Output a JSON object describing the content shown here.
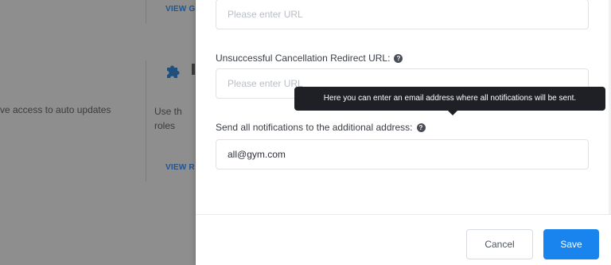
{
  "background": {
    "link_top": "VIEW G",
    "text_left": "ve access to auto updates",
    "desc": "Use th\nroles",
    "link_mid": "VIEW R"
  },
  "form": {
    "url_field": {
      "placeholder": "Please enter URL",
      "value": ""
    },
    "unsuccessful_label": "Unsuccessful Cancellation Redirect URL:",
    "unsuccessful_field": {
      "placeholder": "Please enter URL",
      "value": ""
    },
    "notify_label": "Send all notifications to the additional address:",
    "notify_field": {
      "placeholder": "",
      "value": "all@gym.com"
    },
    "help_glyph": "?"
  },
  "tooltip": {
    "text": "Here you can enter an email address where all notifications will be sent."
  },
  "footer": {
    "cancel_label": "Cancel",
    "save_label": "Save"
  },
  "colors": {
    "primary": "#1a84ee",
    "overlay": "#8e8e8e",
    "tooltip_bg": "#1e2026",
    "link": "#23548a"
  },
  "icons": {
    "puzzle": "puzzle-icon",
    "help": "question-circle-icon"
  }
}
